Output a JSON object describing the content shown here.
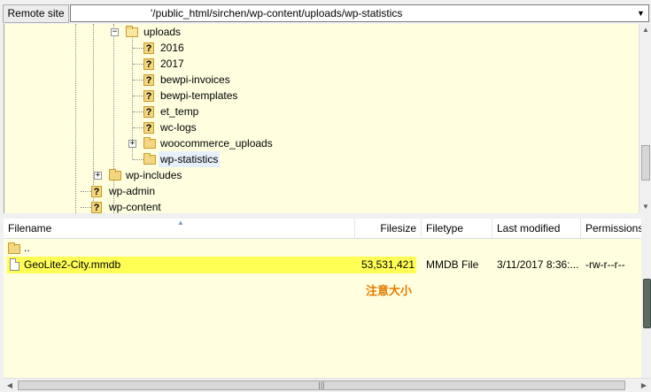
{
  "site_bar": {
    "label": "Remote site",
    "path": "'/public_html/sirchen/wp-content/uploads/wp-statistics",
    "dropdown_icon": "chevron-down-icon"
  },
  "tree": {
    "items": [
      {
        "label": "uploads",
        "icon": "folder-open-icon",
        "expander": "−"
      },
      {
        "label": "2016",
        "icon": "unknown-folder-icon"
      },
      {
        "label": "2017",
        "icon": "unknown-folder-icon"
      },
      {
        "label": "bewpi-invoices",
        "icon": "unknown-folder-icon"
      },
      {
        "label": "bewpi-templates",
        "icon": "unknown-folder-icon"
      },
      {
        "label": "et_temp",
        "icon": "unknown-folder-icon"
      },
      {
        "label": "wc-logs",
        "icon": "unknown-folder-icon"
      },
      {
        "label": "woocommerce_uploads",
        "icon": "folder-icon",
        "expander": "+"
      },
      {
        "label": "wp-statistics",
        "icon": "folder-icon",
        "selected": true
      },
      {
        "label": "wp-includes",
        "icon": "folder-icon",
        "expander": "+"
      },
      {
        "label": "wp-admin",
        "icon": "unknown-folder-icon"
      },
      {
        "label": "wp-content",
        "icon": "unknown-folder-icon"
      }
    ],
    "question_mark": "?"
  },
  "file_list": {
    "columns": {
      "filename": "Filename",
      "filesize": "Filesize",
      "filetype": "Filetype",
      "last_modified": "Last modified",
      "permissions": "Permissions"
    },
    "rows": [
      {
        "name": "..",
        "size": "",
        "type": "",
        "modified": "",
        "perms": "",
        "icon": "folder-icon"
      },
      {
        "name": "GeoLite2-City.mmdb",
        "size": "53,531,421",
        "type": "MMDB File",
        "modified": "3/11/2017 8:36:...",
        "perms": "-rw-r--r--",
        "icon": "file-icon",
        "highlight": true
      }
    ],
    "annotation": "注意大小",
    "highlight_color": "#ffff55",
    "annotation_color": "#e67a00"
  },
  "scrollbar": {
    "grip": "|||"
  }
}
